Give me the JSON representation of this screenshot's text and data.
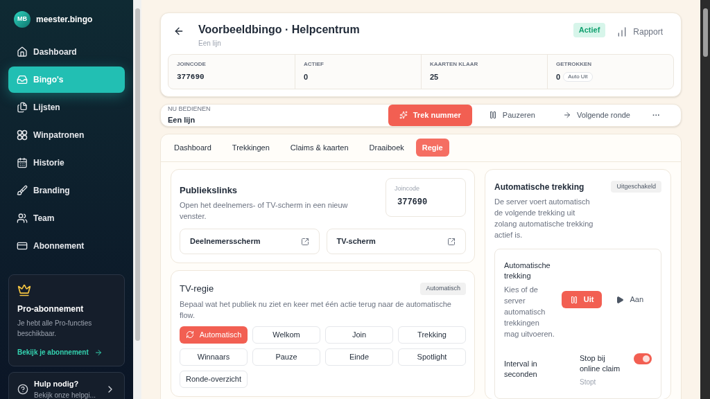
{
  "sidebar": {
    "brand_mark": "MB",
    "brand": "meester.bingo",
    "items": [
      {
        "label": "Dashboard",
        "selected": false
      },
      {
        "label": "Bingo's",
        "selected": true
      },
      {
        "label": "Lijsten",
        "selected": false
      },
      {
        "label": "Winpatronen",
        "selected": false
      },
      {
        "label": "Historie",
        "selected": false
      },
      {
        "label": "Branding",
        "selected": false
      },
      {
        "label": "Team",
        "selected": false
      },
      {
        "label": "Abonnement",
        "selected": false
      }
    ],
    "pro_card": {
      "title": "Pro-abonnement",
      "text": "Je hebt alle Pro-functies beschikbaar.",
      "link": "Bekijk je abonnement"
    },
    "help": {
      "title": "Hulp nodig?",
      "subtitle": "Bekijk onze helpgi..."
    }
  },
  "header": {
    "title": "Voorbeeldbingo · Helpcentrum",
    "subtitle": "Een lijn",
    "status": "Actief",
    "report": "Rapport",
    "stats": [
      {
        "label": "JOINCODE",
        "value": "377690",
        "kind": "code"
      },
      {
        "label": "ACTIEF",
        "value": "0",
        "kind": "number"
      },
      {
        "label": "KAARTEN KLAAR",
        "value": "25",
        "kind": "number"
      },
      {
        "label": "GETROKKEN",
        "value": "0",
        "kind": "number",
        "badge": "Auto Uit"
      }
    ]
  },
  "control_bar": {
    "label": "NU BEDIENEN",
    "value": "Een lijn",
    "actions": [
      {
        "label": "Trek nummer",
        "kind": "primary"
      },
      {
        "label": "Pauzeren",
        "kind": "pause"
      },
      {
        "label": "Volgende ronde",
        "kind": "next"
      },
      {
        "label": "···",
        "kind": "more"
      }
    ]
  },
  "tabs": [
    {
      "label": "Dashboard",
      "selected": false
    },
    {
      "label": "Trekkingen",
      "selected": false
    },
    {
      "label": "Claims & kaarten",
      "selected": false
    },
    {
      "label": "Draaiboek",
      "selected": false
    },
    {
      "label": "Regie",
      "selected": true
    }
  ],
  "public_links": {
    "title": "Publiekslinks",
    "description": "Open het deelnemers- of TV-scherm in een nieuw venster.",
    "joincode_label": "Joincode",
    "joincode": "377690",
    "links": [
      "Deelnemersscherm",
      "TV-scherm"
    ]
  },
  "tv_control": {
    "title": "TV-regie",
    "badge": "Automatisch",
    "description": "Bepaal wat het publiek nu ziet en keer met één actie terug naar de automatische flow.",
    "modes": [
      {
        "label": "Automatisch",
        "selected": true
      },
      {
        "label": "Welkom",
        "selected": false
      },
      {
        "label": "Join",
        "selected": false
      },
      {
        "label": "Trekking",
        "selected": false
      },
      {
        "label": "Winnaars",
        "selected": false
      },
      {
        "label": "Pauze",
        "selected": false
      },
      {
        "label": "Einde",
        "selected": false
      },
      {
        "label": "Spotlight",
        "selected": false
      },
      {
        "label": "Ronde-overzicht",
        "selected": false
      }
    ]
  },
  "auto_draw": {
    "title": "Automatische trekking",
    "badge": "Uitgeschakeld",
    "description": "De server voert automatisch de volgende trekking uit zolang automatische trekking actief is.",
    "setting": {
      "title": "Automatische trekking",
      "description": "Kies of de server automatisch trekkingen mag uitvoeren.",
      "options": [
        {
          "label": "Uit",
          "selected": true
        },
        {
          "label": "Aan",
          "selected": false
        }
      ]
    },
    "interval_label": "Interval in seconden",
    "stop": {
      "label": "Stop bij online claim",
      "on": true,
      "note": "Stopt"
    }
  }
}
